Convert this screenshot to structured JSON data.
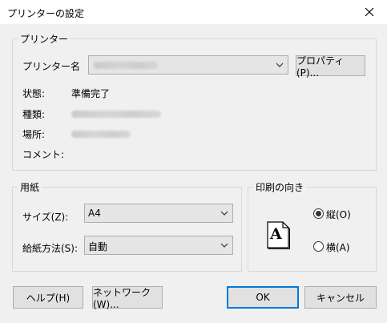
{
  "dialog": {
    "title": "プリンターの設定"
  },
  "printer_group": {
    "label": "プリンター",
    "name_label": "プリンター名",
    "properties_button": "プロパティ(P)...",
    "status_label": "状態:",
    "status_value": "準備完了",
    "type_label": "種類:",
    "location_label": "場所:",
    "comment_label": "コメント:"
  },
  "paper_group": {
    "label": "用紙",
    "size_label": "サイズ(Z):",
    "size_value": "A4",
    "source_label": "給紙方法(S):",
    "source_value": "自動"
  },
  "orientation_group": {
    "label": "印刷の向き",
    "preview_letter": "A",
    "portrait_label": "縦(O)",
    "landscape_label": "横(A)",
    "selected": "portrait"
  },
  "buttons": {
    "help": "ヘルプ(H)",
    "network": "ネットワーク(W)...",
    "ok": "OK",
    "cancel": "キャンセル"
  },
  "colors": {
    "accent": "#0078d7",
    "face": "#f0f0f0"
  }
}
